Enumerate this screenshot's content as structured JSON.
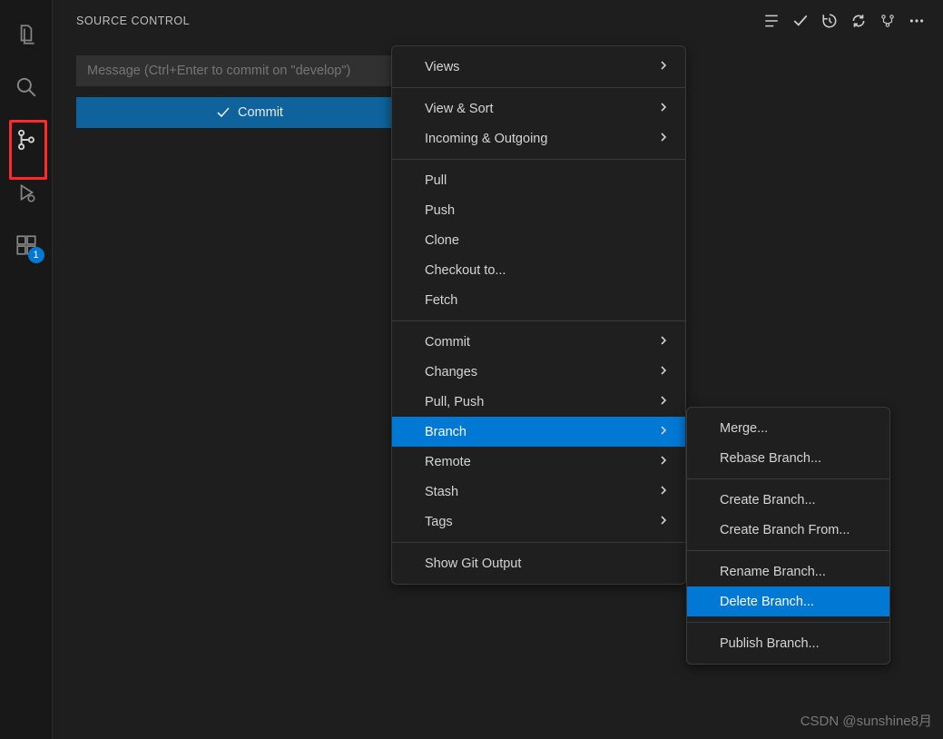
{
  "activity": {
    "items": [
      "explorer",
      "search",
      "source-control",
      "run",
      "extensions"
    ],
    "ext_badge": "1"
  },
  "panel": {
    "title": "SOURCE CONTROL",
    "toolbar_icons": [
      "tree-icon",
      "check-icon",
      "history-icon",
      "refresh-icon",
      "graph-icon",
      "more-icon"
    ],
    "msg_placeholder": "Message (Ctrl+Enter to commit on \"develop\")",
    "commit_label": "Commit"
  },
  "menu_main": {
    "sections": [
      [
        {
          "label": "Views",
          "sub": true
        }
      ],
      [
        {
          "label": "View & Sort",
          "sub": true
        },
        {
          "label": "Incoming & Outgoing",
          "sub": true
        }
      ],
      [
        {
          "label": "Pull"
        },
        {
          "label": "Push"
        },
        {
          "label": "Clone"
        },
        {
          "label": "Checkout to..."
        },
        {
          "label": "Fetch"
        }
      ],
      [
        {
          "label": "Commit",
          "sub": true
        },
        {
          "label": "Changes",
          "sub": true
        },
        {
          "label": "Pull, Push",
          "sub": true
        },
        {
          "label": "Branch",
          "sub": true,
          "selected": true
        },
        {
          "label": "Remote",
          "sub": true
        },
        {
          "label": "Stash",
          "sub": true
        },
        {
          "label": "Tags",
          "sub": true
        }
      ],
      [
        {
          "label": "Show Git Output"
        }
      ]
    ]
  },
  "menu_sub": {
    "sections": [
      [
        {
          "label": "Merge..."
        },
        {
          "label": "Rebase Branch..."
        }
      ],
      [
        {
          "label": "Create Branch..."
        },
        {
          "label": "Create Branch From..."
        }
      ],
      [
        {
          "label": "Rename Branch..."
        },
        {
          "label": "Delete Branch...",
          "selected": true
        }
      ],
      [
        {
          "label": "Publish Branch..."
        }
      ]
    ]
  },
  "watermark": "CSDN @sunshine8月"
}
